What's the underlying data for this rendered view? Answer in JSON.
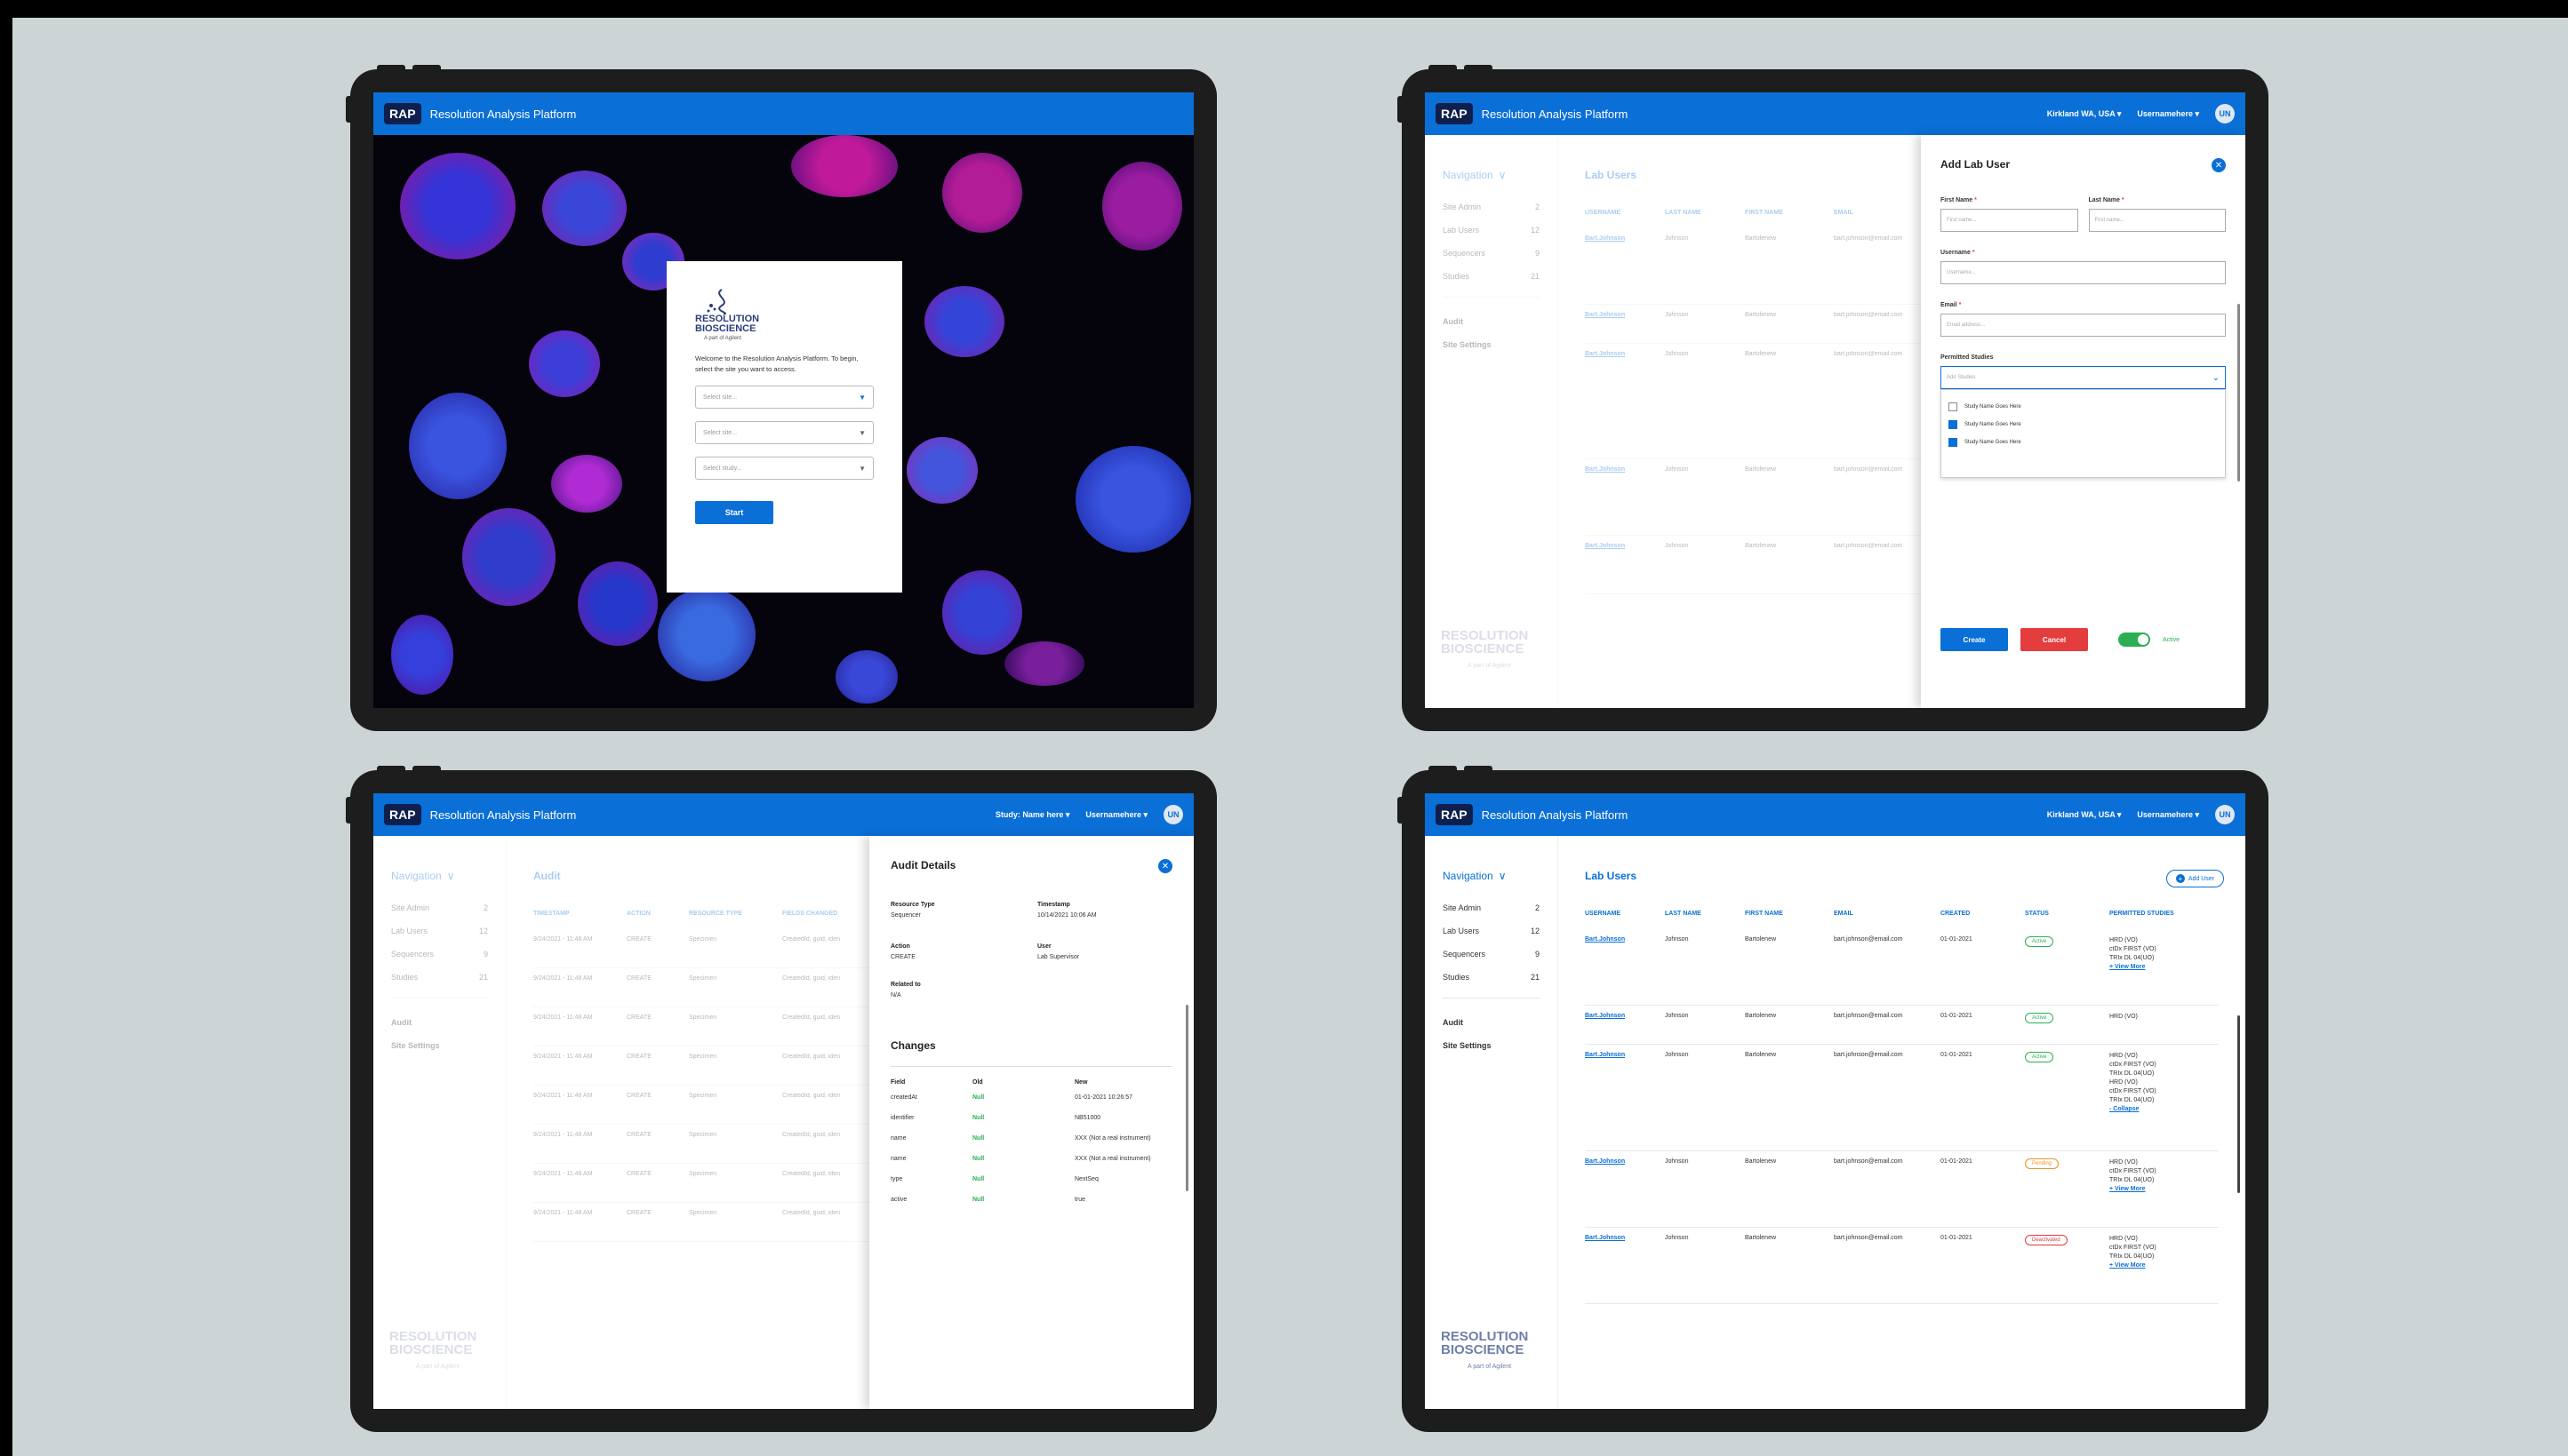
{
  "app": {
    "badge": "RAP",
    "title": "Resolution Analysis Platform"
  },
  "login": {
    "logo_text": [
      "RESOLUTION",
      "BIOSCIENCE"
    ],
    "logo_sub": "A part of Agilent",
    "welcome": "Welcome to the Resolution Analysis Platform. To begin, select the site you want to access.",
    "selects": [
      "Select site...",
      "Select site...",
      "Select study..."
    ],
    "start_label": "Start"
  },
  "topbar": {
    "site": "Kirkland WA, USA",
    "study": "Study: Name here",
    "username": "Usernamehere",
    "initials": "UN"
  },
  "nav": {
    "header": "Navigation",
    "items": [
      {
        "label": "Site Admin",
        "count": "2"
      },
      {
        "label": "Lab Users",
        "count": "12"
      },
      {
        "label": "Sequencers",
        "count": "9"
      },
      {
        "label": "Studies",
        "count": "21"
      }
    ],
    "links": [
      "Audit",
      "Site Settings"
    ],
    "logo_text": [
      "RESOLUTION",
      "BIOSCIENCE"
    ],
    "logo_sub": "A part of Agilent"
  },
  "lab_users": {
    "title": "Lab Users",
    "add_label": "Add User",
    "columns": [
      "USERNAME",
      "LAST NAME",
      "FIRST NAME",
      "EMAIL",
      "CREATED",
      "STATUS",
      "PERMITTED STUDIES"
    ],
    "rows": [
      {
        "username": "Bart.Johnson",
        "last": "Johnson",
        "first": "Bartolenew",
        "email": "bart.johnson@email.com",
        "created": "01-01-2021",
        "status": "Active",
        "studies": [
          "HRD (VO)",
          "ctDx FIRST (VO)",
          "TRIx DL 04(UO)"
        ],
        "more": "+ View More"
      },
      {
        "username": "Bart.Johnson",
        "last": "Johnson",
        "first": "Bartolenew",
        "email": "bart.johnson@email.com",
        "created": "01-01-2021",
        "status": "Active",
        "studies": [
          "HRD (VO)"
        ],
        "more": ""
      },
      {
        "username": "Bart.Johnson",
        "last": "Johnson",
        "first": "Bartolenew",
        "email": "bart.johnson@email.com",
        "created": "01-01-2021",
        "status": "Active",
        "studies": [
          "HRD (VO)",
          "ctDx FIRST (VO)",
          "TRIx DL 04(UO)",
          "HRD (VO)",
          "ctDx FIRST (VO)",
          "TRIx DL 04(UO)"
        ],
        "more": "- Collapse"
      },
      {
        "username": "Bart.Johnson",
        "last": "Johnson",
        "first": "Bartolenew",
        "email": "bart.johnson@email.com",
        "created": "01-01-2021",
        "status": "Pending",
        "studies": [
          "HRD (VO)",
          "ctDx FIRST (VO)",
          "TRIx DL 04(UO)"
        ],
        "more": "+ View More"
      },
      {
        "username": "Bart.Johnson",
        "last": "Johnson",
        "first": "Bartolenew",
        "email": "bart.johnson@email.com",
        "created": "01-01-2021",
        "status": "Deactivated",
        "studies": [
          "HRD (VO)",
          "ctDx FIRST (VO)",
          "TRIx DL 04(UO)"
        ],
        "more": "+ View More"
      }
    ]
  },
  "add_user": {
    "title": "Add Lab User",
    "first_label": "First Name",
    "first_ph": "First name...",
    "last_label": "Last Name",
    "last_ph": "First name...",
    "username_label": "Username",
    "username_ph": "Username...",
    "email_label": "Email",
    "email_ph": "Email address...",
    "studies_label": "Permitted Studies",
    "studies_ph": "Add Studies",
    "study_options": [
      {
        "label": "Study Name Goes Here",
        "checked": false
      },
      {
        "label": "Study Name Goes Here",
        "checked": true
      },
      {
        "label": "Study Name Goes Here",
        "checked": true
      }
    ],
    "create_label": "Create",
    "cancel_label": "Cancel",
    "active_label": "Active"
  },
  "audit": {
    "title": "Audit",
    "columns": [
      "TIMESTAMP",
      "ACTION",
      "RESOURCE TYPE",
      "FIELDS CHANGED"
    ],
    "rows": [
      {
        "ts": "9/24/2021 - 11:48 AM",
        "action": "CREATE",
        "type": "Specimen",
        "fields": "CreatedId, guid, iden"
      },
      {
        "ts": "9/24/2021 - 11:48 AM",
        "action": "CREATE",
        "type": "Specimen",
        "fields": "CreatedId, guid, iden"
      },
      {
        "ts": "9/24/2021 - 11:48 AM",
        "action": "CREATE",
        "type": "Specimen",
        "fields": "CreatedId, guid, iden"
      },
      {
        "ts": "9/24/2021 - 11:48 AM",
        "action": "CREATE",
        "type": "Specimen",
        "fields": "CreatedId, guid, iden"
      },
      {
        "ts": "9/24/2021 - 11:48 AM",
        "action": "CREATE",
        "type": "Specimen",
        "fields": "CreatedId, guid, iden"
      },
      {
        "ts": "9/24/2021 - 11:48 AM",
        "action": "CREATE",
        "type": "Specimen",
        "fields": "CreatedId, guid, iden"
      },
      {
        "ts": "9/24/2021 - 11:48 AM",
        "action": "CREATE",
        "type": "Specimen",
        "fields": "CreatedId, guid, iden"
      },
      {
        "ts": "9/24/2021 - 11:48 AM",
        "action": "CREATE",
        "type": "Specimen",
        "fields": "CreatedId, guid, iden"
      }
    ]
  },
  "audit_details": {
    "title": "Audit Details",
    "resource_type_label": "Resource Type",
    "resource_type": "Sequencer",
    "timestamp_label": "Timestamp",
    "timestamp": "10/14/2021 10:06 AM",
    "action_label": "Action",
    "action": "CREATE",
    "user_label": "User",
    "user": "Lab Supervisor",
    "related_label": "Related to",
    "related": "N/A",
    "changes_title": "Changes",
    "change_cols": [
      "Field",
      "Old",
      "New"
    ],
    "changes": [
      {
        "field": "createdAt",
        "old": "Null",
        "new": "01-01-2021 10:26:57"
      },
      {
        "field": "identifier",
        "old": "Null",
        "new": "NB51000"
      },
      {
        "field": "name",
        "old": "Null",
        "new": "XXX (Not a real instrument)"
      },
      {
        "field": "name",
        "old": "Null",
        "new": "XXX (Not a real instrument)"
      },
      {
        "field": "type",
        "old": "Null",
        "new": "NextSeq"
      },
      {
        "field": "active",
        "old": "Null",
        "new": "true"
      }
    ]
  },
  "colors": {
    "primary": "#0a6fd6",
    "active": "#2cae54",
    "pending": "#e8942a",
    "deactivated": "#e03b3b"
  }
}
